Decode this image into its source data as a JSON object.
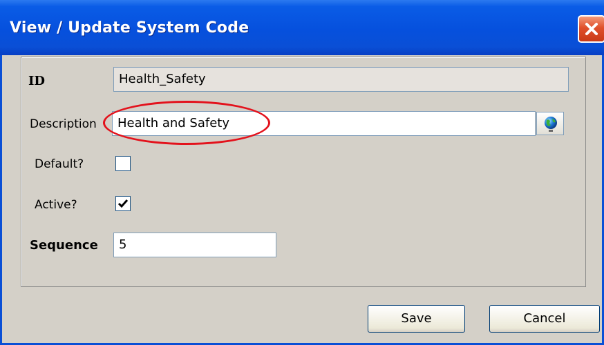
{
  "window": {
    "title": "View / Update System Code"
  },
  "form": {
    "id_label": "ID",
    "id_value": "Health_Safety",
    "description_label": "Description",
    "description_value": "Health and Safety",
    "default_label": "Default?",
    "default_checked": false,
    "active_label": "Active?",
    "active_checked": true,
    "sequence_label": "Sequence",
    "sequence_value": "5"
  },
  "buttons": {
    "save": "Save",
    "cancel": "Cancel"
  },
  "icons": {
    "close": "close-icon",
    "globe": "globe-icon",
    "check": "checkmark-icon"
  },
  "colors": {
    "titlebar": "#0a4fd6",
    "close": "#e0502b",
    "highlight": "#e3121c",
    "dialog_bg": "#d4d0c8"
  }
}
